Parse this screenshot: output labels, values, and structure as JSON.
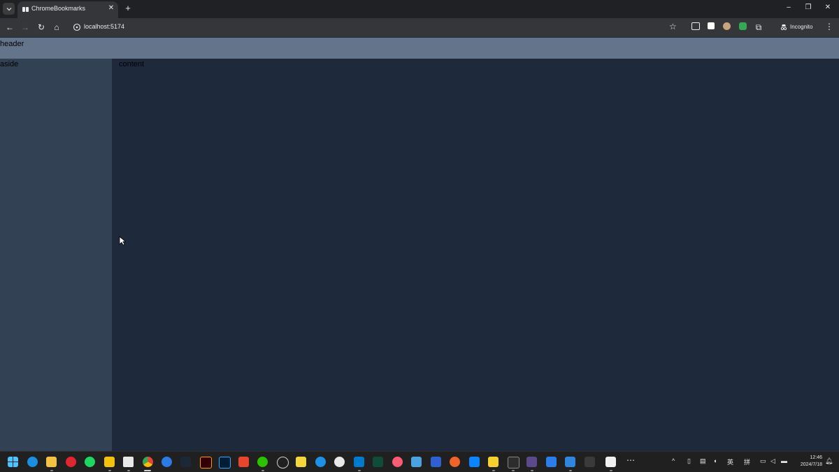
{
  "browser": {
    "tab_title": "ChromeBookmarks",
    "url": "localhost:5174",
    "incognito_label": "Incognito",
    "icons": [
      "tab-search-icon",
      "tab-favicon-icon",
      "close-icon",
      "new-tab-icon",
      "minimize-icon",
      "restore-icon",
      "window-close-icon",
      "back-icon",
      "forward-icon",
      "reload-icon",
      "home-icon",
      "site-info-icon",
      "bookmark-star-icon",
      "extension-icon",
      "puzzle-icon",
      "incognito-icon",
      "kebab-menu-icon"
    ]
  },
  "page": {
    "header_label": "header",
    "aside_label": "aside",
    "content_label": "content",
    "colors": {
      "header": "#64748b",
      "aside": "#334155",
      "content": "#1e293b"
    }
  },
  "taskbar": {
    "tray_ime_1": "英",
    "tray_ime_2": "拼",
    "time": "12:46",
    "date": "2024/7/18",
    "apps": [
      "windows-start",
      "edge",
      "file-explorer",
      "netease-music",
      "spotify",
      "app-yellow",
      "app-fox",
      "chrome",
      "app-blue",
      "steam",
      "illustrator",
      "photoshop",
      "app-red",
      "wechat",
      "app-circle",
      "app-notes",
      "app-docker",
      "app-ball",
      "vscode",
      "app-terminal-dark",
      "itunes",
      "app-window",
      "app-blue-window",
      "app-orange",
      "app-blue-wave",
      "app-yellow-card",
      "terminal",
      "app-cat",
      "app-mail",
      "app-check",
      "app-s",
      "typora",
      "more"
    ]
  }
}
